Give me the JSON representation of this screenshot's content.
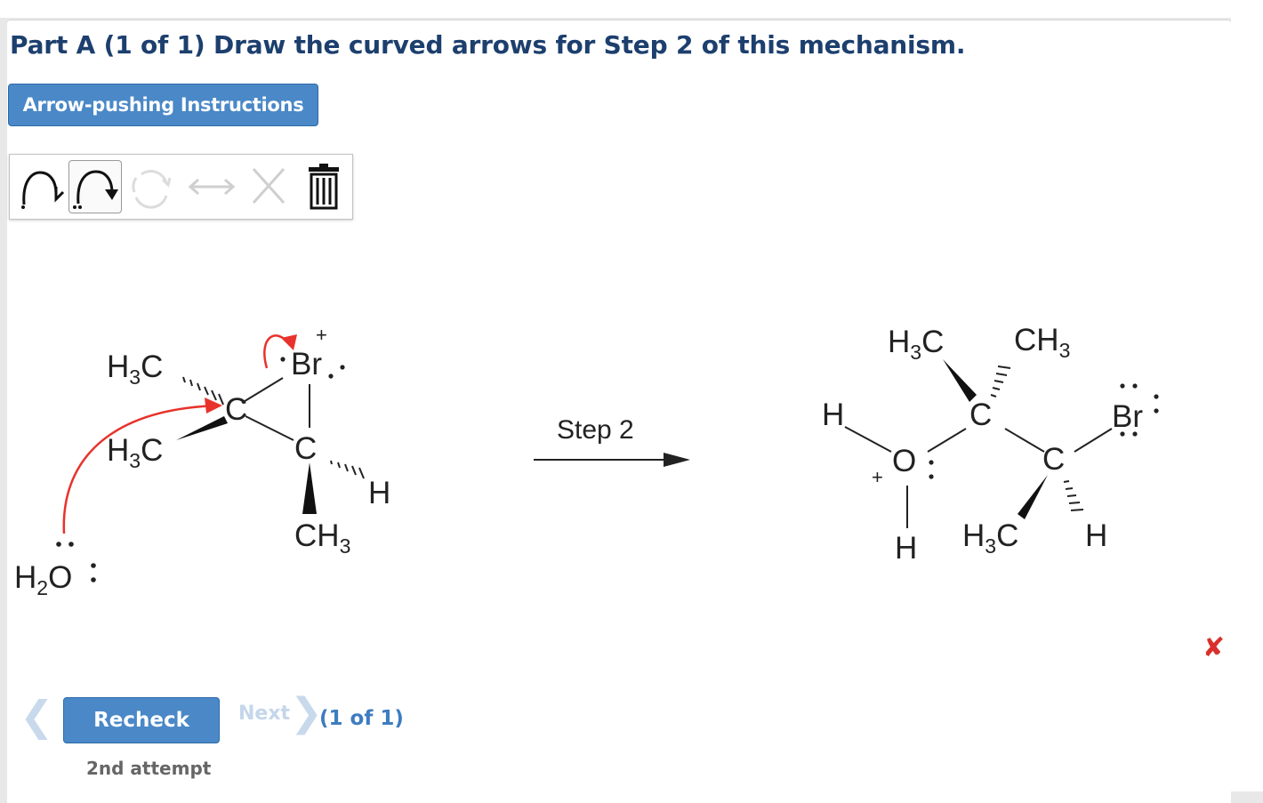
{
  "header": {
    "title": "Part A (1 of 1) Draw the curved arrows for Step 2 of this mechanism.",
    "instructions_button": "Arrow-pushing Instructions"
  },
  "toolbar": {
    "tools": [
      {
        "id": "single-electron-arrow",
        "icon": "fishhook-arrow-icon"
      },
      {
        "id": "electron-pair-arrow",
        "icon": "curved-arrow-icon",
        "selected": true
      },
      {
        "id": "rotate",
        "icon": "rotate-icon",
        "disabled": true
      },
      {
        "id": "resonance",
        "icon": "double-arrow-icon",
        "disabled": true
      },
      {
        "id": "delete",
        "icon": "x-icon",
        "disabled": true
      },
      {
        "id": "clear",
        "icon": "trash-icon"
      }
    ]
  },
  "mechanism": {
    "reactant": {
      "labels": {
        "h3c_top": "H3C",
        "h3c_mid": "H3C",
        "c_left": "C",
        "br": "Br",
        "br_charge": "+",
        "c_right": "C",
        "h_right": "H",
        "ch3_bottom": "CH3"
      },
      "nucleophile": "H2O",
      "nucleophile_lone_pairs": ":"
    },
    "step_label": "Step 2",
    "product": {
      "labels": {
        "h3c_top": "H3C",
        "ch3_top": "CH3",
        "h_left": "H",
        "c_center": "C",
        "o": "O",
        "o_charge": "+",
        "br": "Br",
        "c_right": "C",
        "h_bottom_left": "H",
        "h3c_bottom": "H3C",
        "h_bottom_right": "H"
      }
    },
    "arrow_color": "#e8322b"
  },
  "nav": {
    "prev_label": "❮",
    "recheck_label": "Recheck",
    "next_label": "Next",
    "next_arrow": "❯",
    "page_count": "(1 of 1)",
    "attempt_label": "2nd attempt"
  },
  "status": {
    "icon": "incorrect-x-icon",
    "symbol": "✘",
    "color": "#d9302c"
  }
}
